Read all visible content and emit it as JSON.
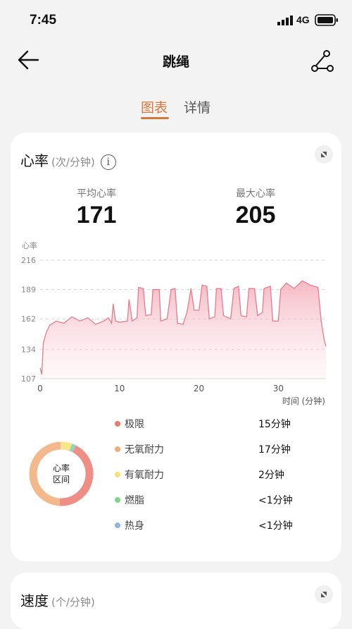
{
  "status": {
    "time": "7:45",
    "network": "4G"
  },
  "nav": {
    "title": "跳绳"
  },
  "tabs": [
    {
      "label": "图表"
    },
    {
      "label": "详情"
    }
  ],
  "heart": {
    "title": "心率",
    "unit": "(次/分钟)",
    "avg_label": "平均心率",
    "avg_value": "171",
    "max_label": "最大心率",
    "max_value": "205",
    "zone_center": [
      "心率",
      "区间"
    ],
    "zones": [
      {
        "name": "极限",
        "value": "15分钟",
        "color": "#ec7a6f",
        "minutes": 15
      },
      {
        "name": "无氧耐力",
        "value": "17分钟",
        "color": "#f1ad78",
        "minutes": 17
      },
      {
        "name": "有氧耐力",
        "value": "2分钟",
        "color": "#f7df77",
        "minutes": 2
      },
      {
        "name": "燃脂",
        "value": "<1分钟",
        "color": "#7cd58a",
        "minutes": 0.5
      },
      {
        "name": "热身",
        "value": "<1分钟",
        "color": "#8fb4e2",
        "minutes": 0.3
      }
    ]
  },
  "chart_data": {
    "type": "area",
    "ylabel": "心率",
    "xlabel": "时间 (分钟)",
    "ylim": [
      107,
      216
    ],
    "xlim": [
      0,
      36
    ],
    "yticks": [
      216,
      189,
      162,
      134,
      107
    ],
    "xticks": [
      0,
      10,
      20,
      30
    ],
    "grid": true,
    "color": "#e77b8c",
    "points": [
      [
        0,
        117
      ],
      [
        0.2,
        111
      ],
      [
        0.4,
        140
      ],
      [
        0.8,
        150
      ],
      [
        1.2,
        156
      ],
      [
        2,
        160
      ],
      [
        3,
        158
      ],
      [
        4,
        164
      ],
      [
        5,
        160
      ],
      [
        6,
        163
      ],
      [
        7,
        157
      ],
      [
        8,
        160
      ],
      [
        8.6,
        163
      ],
      [
        9,
        158
      ],
      [
        9.2,
        176
      ],
      [
        9.5,
        160
      ],
      [
        10,
        159
      ],
      [
        11,
        160
      ],
      [
        11.2,
        180
      ],
      [
        11.6,
        160
      ],
      [
        12.2,
        163
      ],
      [
        12.4,
        191
      ],
      [
        13,
        190
      ],
      [
        13.3,
        165
      ],
      [
        14,
        166
      ],
      [
        14.2,
        189
      ],
      [
        15,
        189
      ],
      [
        15.2,
        160
      ],
      [
        16,
        162
      ],
      [
        16.5,
        189
      ],
      [
        17,
        190
      ],
      [
        17.3,
        158
      ],
      [
        18,
        157
      ],
      [
        18.5,
        168
      ],
      [
        19,
        190
      ],
      [
        19.4,
        170
      ],
      [
        20,
        170
      ],
      [
        20.4,
        193
      ],
      [
        21,
        192
      ],
      [
        21.3,
        162
      ],
      [
        22,
        164
      ],
      [
        22.2,
        190
      ],
      [
        22.8,
        190
      ],
      [
        23.1,
        165
      ],
      [
        24,
        162
      ],
      [
        24.4,
        190
      ],
      [
        25,
        192
      ],
      [
        25.3,
        165
      ],
      [
        26,
        164
      ],
      [
        26.3,
        190
      ],
      [
        27,
        190
      ],
      [
        27.4,
        165
      ],
      [
        28,
        168
      ],
      [
        28.2,
        190
      ],
      [
        29,
        192
      ],
      [
        29.3,
        160
      ],
      [
        30,
        160
      ],
      [
        30.3,
        189
      ],
      [
        31,
        195
      ],
      [
        32,
        190
      ],
      [
        33,
        197
      ],
      [
        33.6,
        195
      ],
      [
        34,
        193
      ],
      [
        35,
        191
      ],
      [
        35.4,
        160
      ],
      [
        35.8,
        142
      ],
      [
        36,
        137
      ]
    ]
  },
  "speed": {
    "title": "速度",
    "unit": "(个/分钟)"
  }
}
